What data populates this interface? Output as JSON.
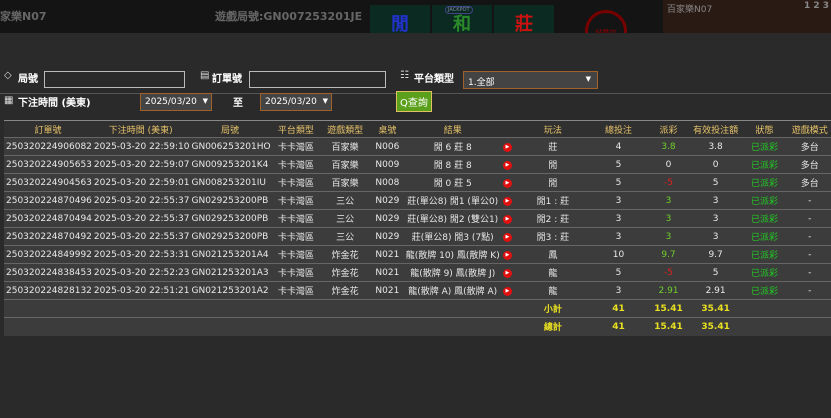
{
  "background": {
    "table_label": "家樂N07",
    "round_label": "遊戲局號:GN007253201JE",
    "bets": [
      "閒",
      "和",
      "莊"
    ],
    "jackpot": "JACKPOT",
    "status": "結算中",
    "video_label": "百家樂N07",
    "video_nums": "1 2 3"
  },
  "filters": {
    "round_label": "局號",
    "round_value": "",
    "order_label": "訂單號",
    "order_value": "",
    "platform_label": "平台類型",
    "platform_value": "1.全部",
    "time_label": "下注時間 (美東)",
    "date_from": "2025/03/20",
    "to_label": "至",
    "date_to": "2025/03/20",
    "search_label": "查詢"
  },
  "table": {
    "headers": [
      "訂單號",
      "下注時間 (美東)",
      "局號",
      "平台類型",
      "遊戲類型",
      "桌號",
      "結果",
      "",
      "玩法",
      "總投注",
      "派彩",
      "有效投注額",
      "狀態",
      "遊戲模式"
    ],
    "rows": [
      [
        "250320224906082",
        "2025-03-20 22:59:10",
        "GN006253201HO",
        "卡卡灣區",
        "百家樂",
        "N006",
        "閒 6 莊 8",
        "莊",
        "4",
        "3.8",
        "3.8",
        "已派彩",
        "多台"
      ],
      [
        "250320224905653",
        "2025-03-20 22:59:07",
        "GN009253201K4",
        "卡卡灣區",
        "百家樂",
        "N009",
        "閒 8 莊 8",
        "閒",
        "5",
        "0",
        "0",
        "已派彩",
        "多台"
      ],
      [
        "250320224904563",
        "2025-03-20 22:59:01",
        "GN008253201IU",
        "卡卡灣區",
        "百家樂",
        "N008",
        "閒 0 莊 5",
        "閒",
        "5",
        "-5",
        "5",
        "已派彩",
        "多台"
      ],
      [
        "250320224870496",
        "2025-03-20 22:55:37",
        "GN029253200PB",
        "卡卡灣區",
        "三公",
        "N029",
        "莊(單公8) 閒1 (單公0)",
        "閒1 : 莊",
        "3",
        "3",
        "3",
        "已派彩",
        "-"
      ],
      [
        "250320224870494",
        "2025-03-20 22:55:37",
        "GN029253200PB",
        "卡卡灣區",
        "三公",
        "N029",
        "莊(單公8) 閒2 (雙公1)",
        "閒2 : 莊",
        "3",
        "3",
        "3",
        "已派彩",
        "-"
      ],
      [
        "250320224870492",
        "2025-03-20 22:55:37",
        "GN029253200PB",
        "卡卡灣區",
        "三公",
        "N029",
        "莊(單公8) 閒3 (7點)",
        "閒3 : 莊",
        "3",
        "3",
        "3",
        "已派彩",
        "-"
      ],
      [
        "250320224849992",
        "2025-03-20 22:53:31",
        "GN021253201A4",
        "卡卡灣區",
        "炸金花",
        "N021",
        "龍(散牌 10) 鳳(散牌 K)",
        "鳳",
        "10",
        "9.7",
        "9.7",
        "已派彩",
        "-"
      ],
      [
        "250320224838453",
        "2025-03-20 22:52:23",
        "GN021253201A3",
        "卡卡灣區",
        "炸金花",
        "N021",
        "龍(散牌 9) 鳳(散牌 J)",
        "龍",
        "5",
        "-5",
        "5",
        "已派彩",
        "-"
      ],
      [
        "250320224828132",
        "2025-03-20 22:51:21",
        "GN021253201A2",
        "卡卡灣區",
        "炸金花",
        "N021",
        "龍(散牌 A) 鳳(散牌 A)",
        "龍",
        "3",
        "2.91",
        "2.91",
        "已派彩",
        "-"
      ]
    ],
    "subtotal": {
      "label": "小計",
      "bet": "41",
      "payout": "15.41",
      "valid": "35.41"
    },
    "total": {
      "label": "總計",
      "bet": "41",
      "payout": "15.41",
      "valid": "35.41"
    }
  },
  "colors": {
    "header_text": "#e6c26a",
    "positive": "#6fcf2a",
    "negative": "#e02020",
    "status": "#22cc22",
    "total": "#e8e020",
    "search_button": "#5aa01a"
  }
}
